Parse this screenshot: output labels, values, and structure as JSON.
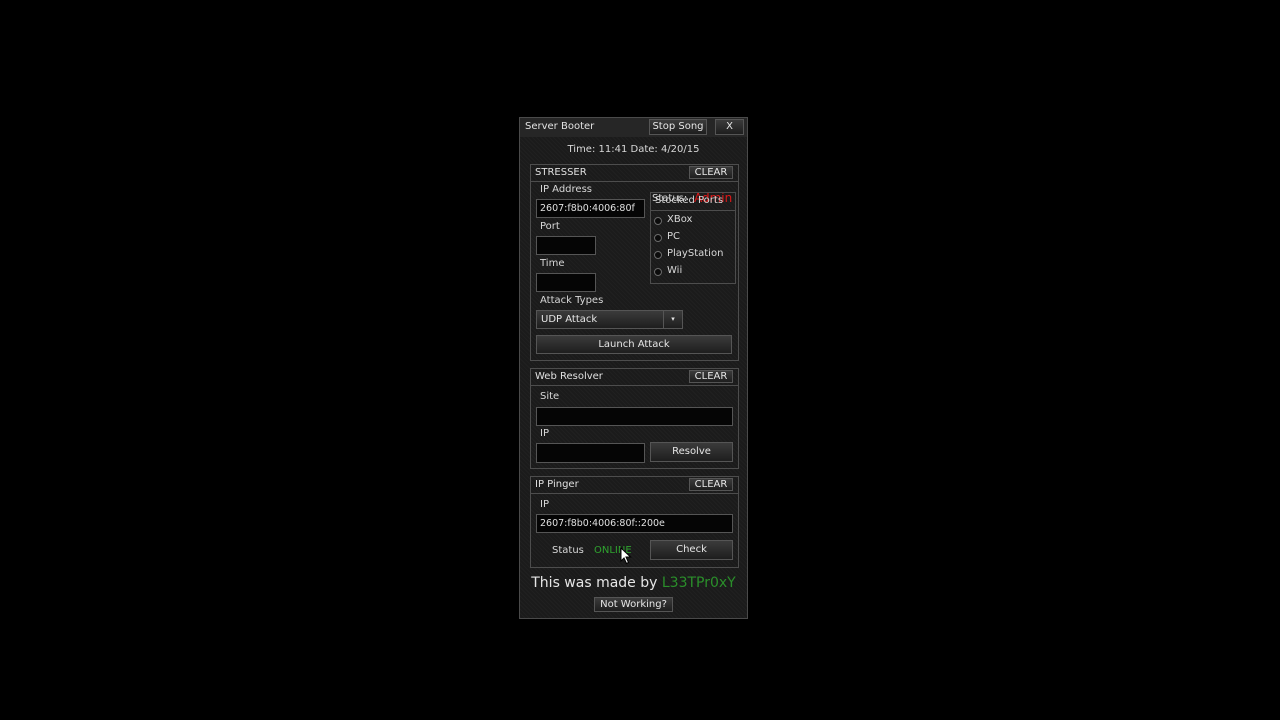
{
  "window": {
    "title": "Server Booter",
    "stop_song_label": "Stop Song",
    "close_label": "X"
  },
  "datetime": "Time: 11:41 Date: 4/20/15",
  "stresser": {
    "title": "STRESSER",
    "clear_label": "CLEAR",
    "ip_label": "IP Address",
    "ip_value": "2607:f8b0:4006:80f",
    "port_label": "Port",
    "port_value": "",
    "time_label": "Time",
    "time_value": "",
    "status_label": "Status:",
    "status_value": "Admin",
    "status_color": "#e01818",
    "attack_types_label": "Attack Types",
    "attack_type_selected": "UDP Attack",
    "launch_label": "Launch Attack",
    "stocked_ports": {
      "title": "Stocked Ports",
      "options": [
        "XBox",
        "PC",
        "PlayStation",
        "Wii"
      ]
    }
  },
  "web_resolver": {
    "title": "Web Resolver",
    "clear_label": "CLEAR",
    "site_label": "Site",
    "site_value": "",
    "ip_label": "IP",
    "ip_value": "",
    "resolve_label": "Resolve"
  },
  "ip_pinger": {
    "title": "IP Pinger",
    "clear_label": "CLEAR",
    "ip_label": "IP",
    "ip_value": "2607:f8b0:4006:80f::200e",
    "status_label": "Status",
    "status_value": "ONLINE",
    "status_color": "#2fa32f",
    "check_label": "Check"
  },
  "footer": {
    "made_by_prefix": "This was made by",
    "author": "L33TPr0xY",
    "author_color": "#2a8f2a",
    "not_working_label": "Not Working?"
  }
}
